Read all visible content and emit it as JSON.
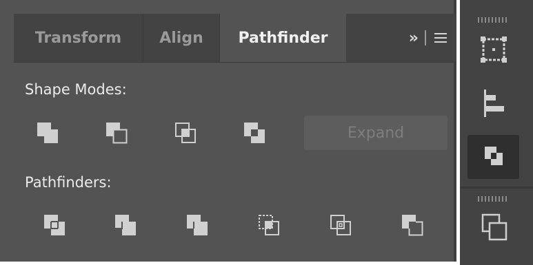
{
  "tabs": [
    {
      "label": "Transform",
      "active": false
    },
    {
      "label": "Align",
      "active": false
    },
    {
      "label": "Pathfinder",
      "active": true
    }
  ],
  "tab_controls": {
    "overflow": "»",
    "menu_icon": "hamburger-menu-icon"
  },
  "shape_modes": {
    "label": "Shape Modes:",
    "buttons": [
      "unite-icon",
      "minus-front-icon",
      "intersect-icon",
      "exclude-icon"
    ],
    "expand_label": "Expand"
  },
  "pathfinders": {
    "label": "Pathfinders:",
    "buttons": [
      "divide-icon",
      "trim-icon",
      "merge-icon",
      "crop-icon",
      "outline-icon",
      "minus-back-icon"
    ]
  },
  "sidebar": {
    "buttons": [
      "transform-panel-icon",
      "align-panel-icon",
      "pathfinder-panel-icon",
      "layers-panel-icon"
    ],
    "active": "pathfinder-panel-icon"
  },
  "colors": {
    "panel_bg": "#535353",
    "tab_bg": "#434343",
    "icon_fill": "#d0d0d0",
    "text": "#ebebeb",
    "disabled_text": "#7e7e7e"
  }
}
